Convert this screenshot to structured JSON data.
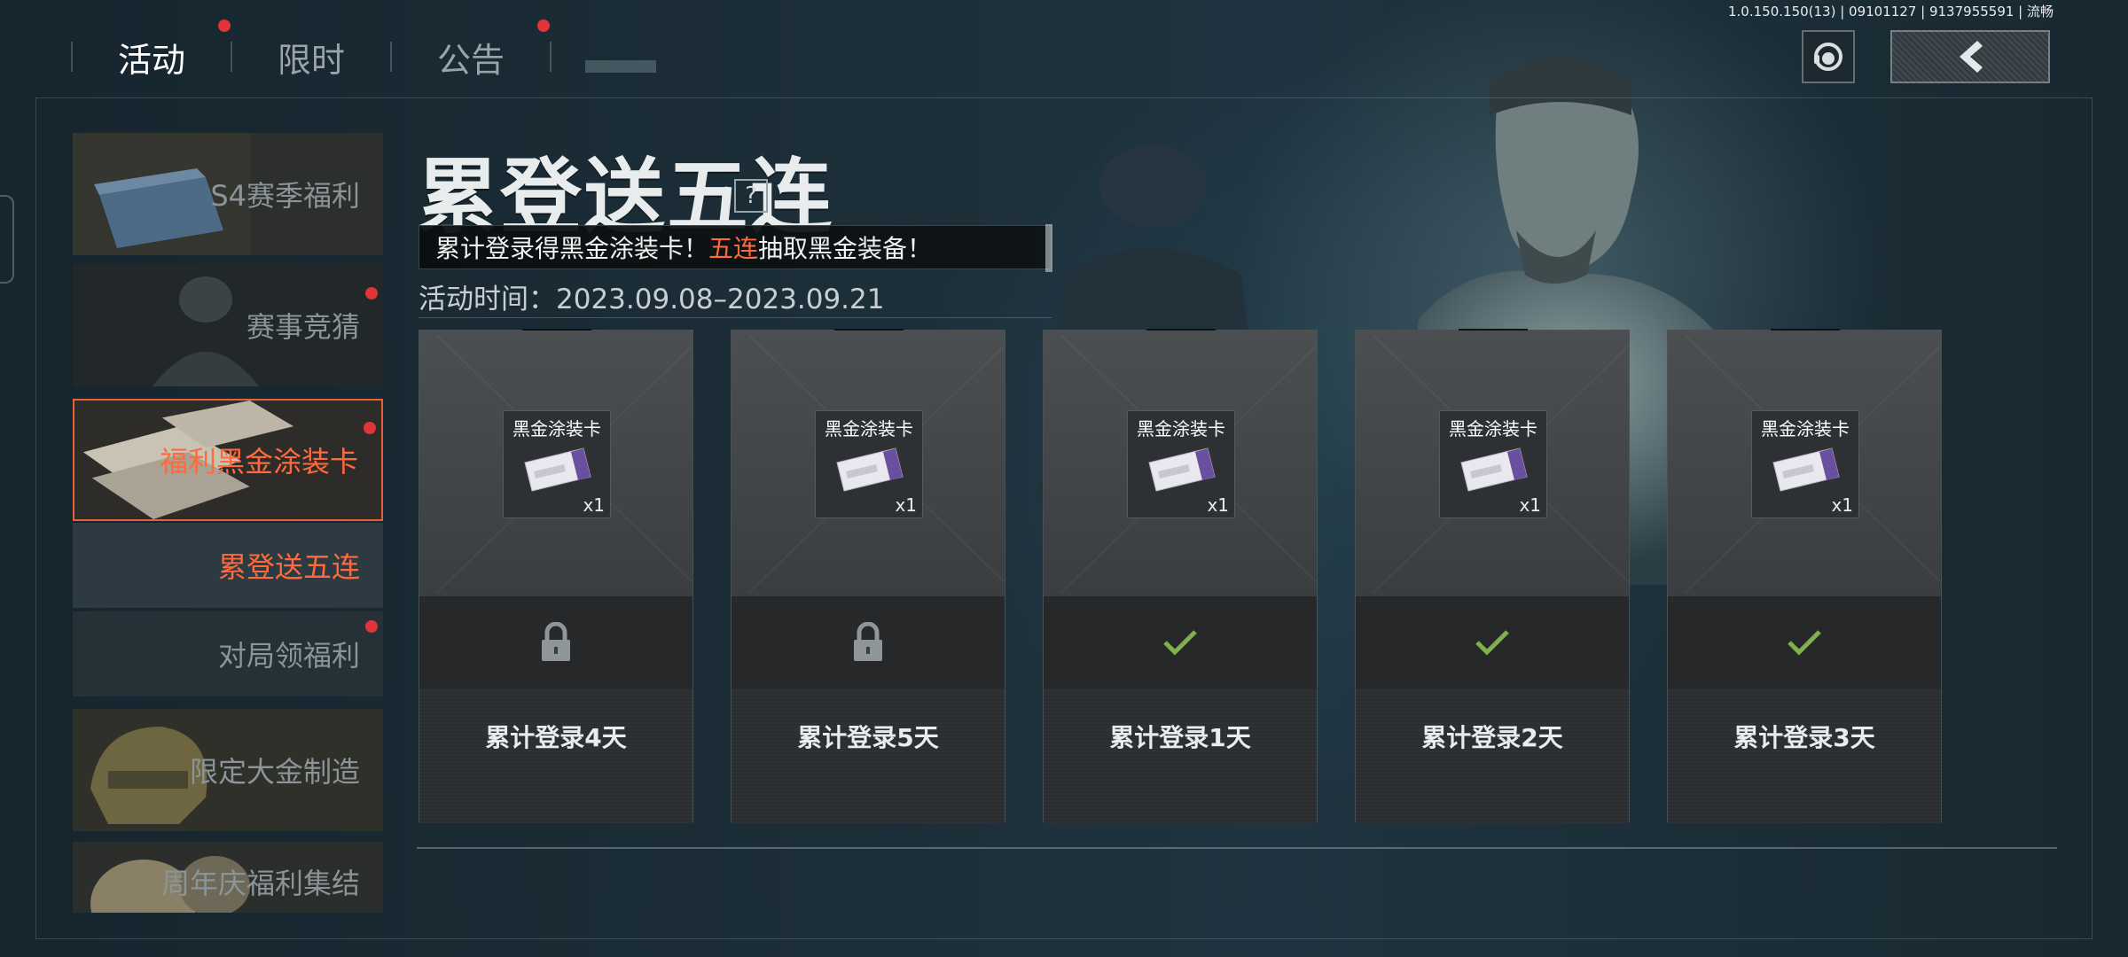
{
  "version": "1.0.150.150(13) | 09101127 | 9137955591 | 流畅",
  "topnav": {
    "tabs": [
      {
        "label": "活动",
        "active": true,
        "dot": true
      },
      {
        "label": "限时",
        "active": false,
        "dot": false
      },
      {
        "label": "公告",
        "active": false,
        "dot": true
      }
    ]
  },
  "sidebar": {
    "items": [
      {
        "label": "S4赛季福利"
      },
      {
        "label": "赛事竞猜"
      },
      {
        "label": "福利黑金涂装卡"
      },
      {
        "label": "累登送五连"
      },
      {
        "label": "对局领福利"
      },
      {
        "label": "限定大金制造"
      },
      {
        "label": "周年庆福利集结"
      }
    ]
  },
  "main": {
    "title": "累登送五连",
    "help": "?",
    "subtitle_pre": "累计登录得黑金涂装卡！",
    "subtitle_hl": "五连",
    "subtitle_post": "抽取黑金装备！",
    "period": "活动时间：2023.09.08–2023.09.21",
    "cards": [
      {
        "item": "黑金涂装卡",
        "qty": "x1",
        "status": "locked",
        "day": "累计登录4天"
      },
      {
        "item": "黑金涂装卡",
        "qty": "x1",
        "status": "locked",
        "day": "累计登录5天"
      },
      {
        "item": "黑金涂装卡",
        "qty": "x1",
        "status": "claimed",
        "day": "累计登录1天"
      },
      {
        "item": "黑金涂装卡",
        "qty": "x1",
        "status": "claimed",
        "day": "累计登录2天"
      },
      {
        "item": "黑金涂装卡",
        "qty": "x1",
        "status": "claimed",
        "day": "累计登录3天"
      }
    ]
  },
  "colors": {
    "accent": "#ff6a3c",
    "notify_dot": "#e0343a",
    "check": "#7fb24a"
  }
}
